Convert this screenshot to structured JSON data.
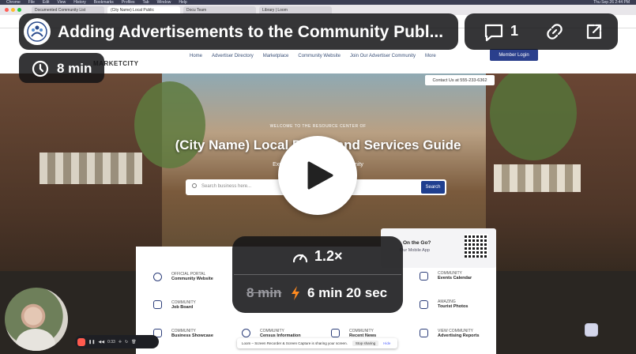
{
  "menubar": {
    "items": [
      "Chrome",
      "File",
      "Edit",
      "View",
      "History",
      "Bookmarks",
      "Profiles",
      "Tab",
      "Window",
      "Help"
    ],
    "clock": "Thu Sep 26 2:44 PM"
  },
  "tabs": [
    "Documented Community List",
    "(City Name) Local Public",
    "Docu Team",
    "Library | Loom"
  ],
  "site": {
    "logo_text": "MARKETCITY",
    "nav": [
      "Home",
      "Advertiser Directory",
      "Marketplace",
      "Community Website",
      "Join Our Advertiser Community",
      "More"
    ],
    "member_button": "Member Login",
    "contact": "Contact Us at 555-233-6362",
    "welcome": "WELCOME TO THE RESOURCE CENTER OF",
    "hero_title": "(City Name) Local Public and Services Guide",
    "hero_sub": "Explore and Support Our Community",
    "search_placeholder": "Search business here...",
    "search_button": "Search",
    "on_the_go_title": "On the Go?",
    "on_the_go_sub": "Our Mobile App",
    "services": [
      {
        "tag": "OFFICIAL PORTAL",
        "label": "Community Website"
      },
      {
        "tag": "COMMUNITY",
        "label": "Job Board"
      },
      {
        "tag": "COMMUNITY",
        "label": "Business Showcase"
      },
      {
        "tag": "COMMUNITY",
        "label": "Census Information"
      },
      {
        "tag": "COMMUNITY",
        "label": "Recent News"
      },
      {
        "tag": "COMMUNITY",
        "label": "Events Calendar"
      },
      {
        "tag": "AMAZING",
        "label": "Tourist Photos"
      },
      {
        "tag": "VIEW COMMUNITY",
        "label": "Advertising Reports"
      }
    ]
  },
  "loom_share": {
    "text": "Loom – Screen Recorder & Screen Capture is sharing your screen.",
    "stop": "Stop sharing",
    "hide": "Hide"
  },
  "recorder": {
    "time": "0:33"
  },
  "overlay": {
    "title": "Adding Advertisements to the Community Publ...",
    "comment_count": "1",
    "duration": "8 min",
    "speed": "1.2×",
    "original_duration": "8 min",
    "new_duration": "6 min 20 sec"
  },
  "colors": {
    "accent": "#1f3f8f",
    "overlay_bg": "#141416",
    "record": "#ff5a4e"
  }
}
